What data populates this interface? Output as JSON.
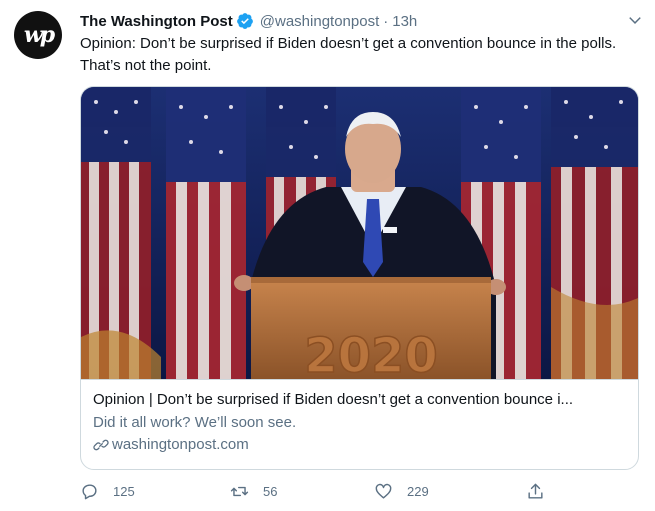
{
  "tweet": {
    "avatar_text": "wp",
    "display_name": "The Washington Post",
    "handle": "@washingtonpost",
    "separator": "·",
    "time": "13h",
    "text": "Opinion: Don’t be surprised if Biden doesn’t get a convention bounce in the polls. That’s not the point."
  },
  "card": {
    "image_alt": "Joe Biden speaking at podium in front of American flags",
    "podium_text": "2020",
    "title": "Opinion | Don’t be surprised if Biden doesn’t get a convention bounce i...",
    "description": "Did it all work? We’ll soon see.",
    "domain": "washingtonpost.com"
  },
  "actions": {
    "reply_count": "125",
    "retweet_count": "56",
    "like_count": "229"
  },
  "colors": {
    "verified": "#1da1f2",
    "secondary_text": "#5b7083",
    "border": "#cfd9de"
  }
}
